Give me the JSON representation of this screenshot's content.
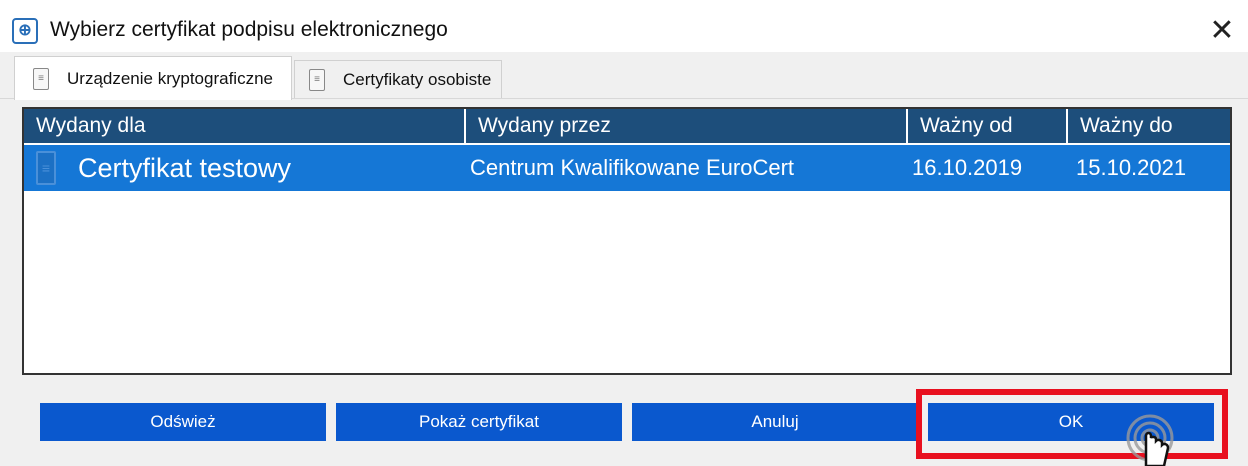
{
  "window": {
    "title": "Wybierz certyfikat podpisu elektronicznego",
    "icon": "app-icon",
    "close_label": "✕"
  },
  "tabs": [
    {
      "label": "Urządzenie kryptograficzne",
      "icon": "certificate-icon",
      "active": true
    },
    {
      "label": "Certyfikaty osobiste",
      "icon": "certificate-icon",
      "active": false
    }
  ],
  "table": {
    "columns": [
      "Wydany dla",
      "Wydany przez",
      "Ważny od",
      "Ważny do"
    ],
    "rows": [
      {
        "issued_to": "Certyfikat testowy",
        "issued_by": "Centrum Kwalifikowane EuroCert",
        "valid_from": "16.10.2019",
        "valid_to": "15.10.2021",
        "selected": true
      }
    ]
  },
  "buttons": {
    "refresh": "Odśwież",
    "show_certificate": "Pokaż certyfikat",
    "cancel": "Anuluj",
    "ok": "OK"
  },
  "colors": {
    "header_bg": "#1d4e7b",
    "selected_row": "#1577d6",
    "button_bg": "#0a58ce",
    "highlight": "#e8101f"
  }
}
